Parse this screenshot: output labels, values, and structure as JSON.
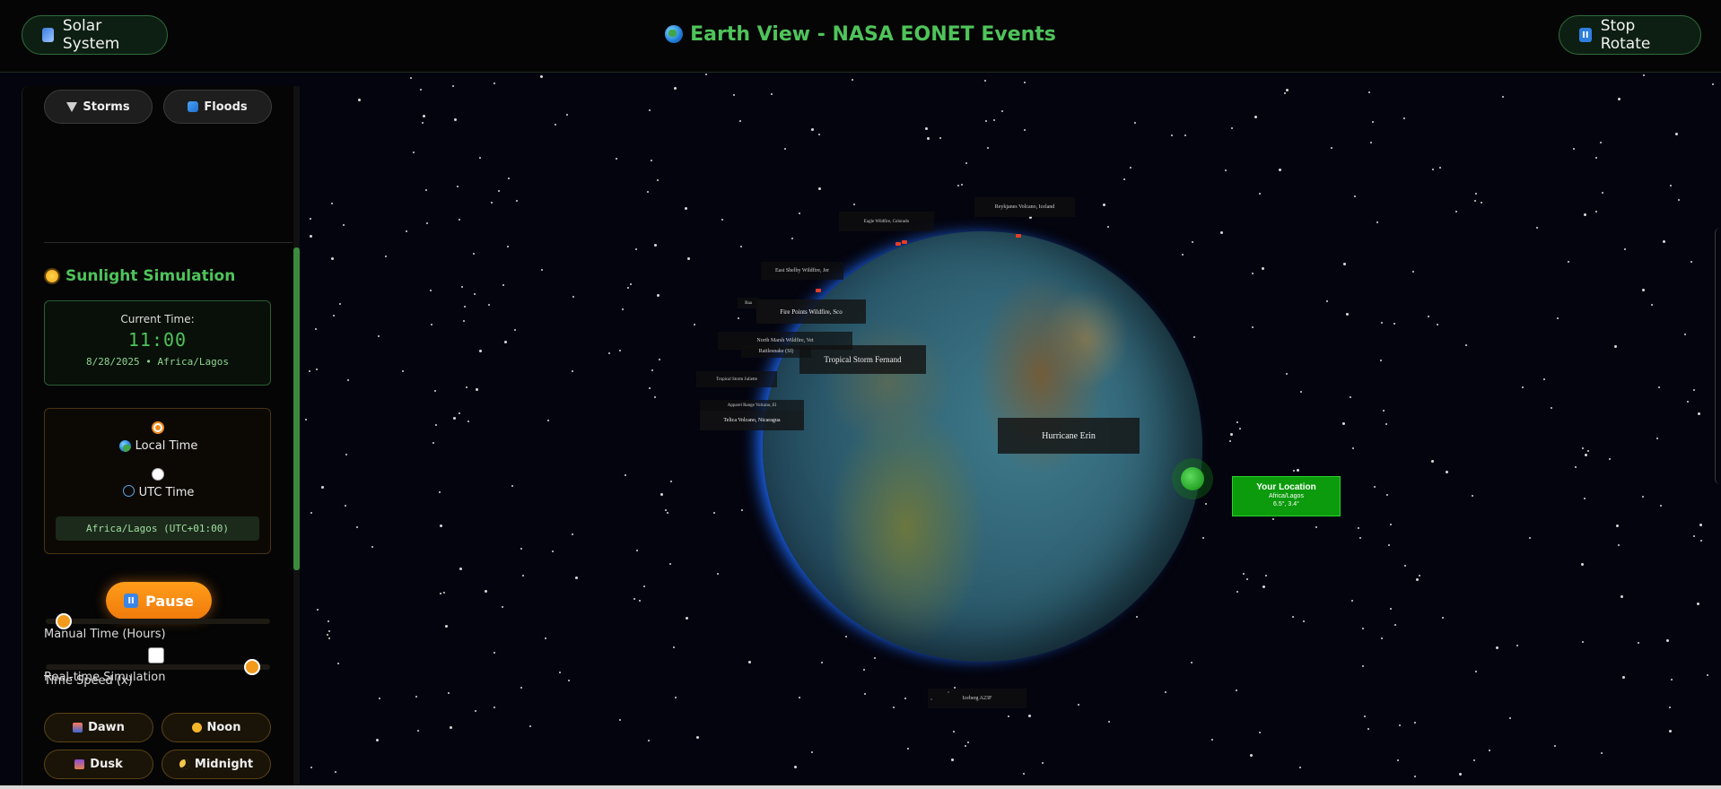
{
  "header": {
    "title": "Earth View - NASA EONET Events",
    "left_button": "Solar System",
    "right_button": "Stop Rotate"
  },
  "sidebar": {
    "filters": [
      {
        "label": "Storms",
        "icon": "tornado-icon"
      },
      {
        "label": "Floods",
        "icon": "wave-icon"
      }
    ],
    "section_title": "Sunlight Simulation",
    "current_time": {
      "label": "Current Time:",
      "value": "11:00",
      "date_zone": "8/28/2025 • Africa/Lagos"
    },
    "time_mode": {
      "options": [
        {
          "label": "Local Time",
          "selected": true
        },
        {
          "label": "UTC Time",
          "selected": false
        }
      ],
      "timezone_display": "Africa/Lagos (UTC+01:00)"
    },
    "pause_button": "Pause",
    "realtime_label": "Real-time Simulation",
    "realtime_checked": false,
    "manual_time_label": "Manual Time (Hours)",
    "manual_time_fraction": 0.08,
    "speed_label": "Time Speed (x)",
    "speed_fraction": 0.92,
    "presets": [
      "Dawn",
      "Noon",
      "Dusk",
      "Midnight"
    ]
  },
  "scene": {
    "events": [
      "Tropical Storm Fernand",
      "Hurricane Erin",
      "Fire Points Wildfire, Sco",
      "East Shelby Wildfire, Jer",
      "North Marsh Wildfire, Vet",
      "Rattlesnake (SI)",
      "Tropical Storm Juliette",
      "Telica Volcano, Nicaragua",
      "Apparel Range Volcano, El",
      "Eagle Wildfire, Colorado",
      "Reykjanes Volcano, Iceland",
      "Iceberg A23F",
      "Raa"
    ],
    "location_label": {
      "title": "Your Location",
      "place": "Africa/Lagos",
      "coords": "6.5°, 3.4°"
    }
  }
}
